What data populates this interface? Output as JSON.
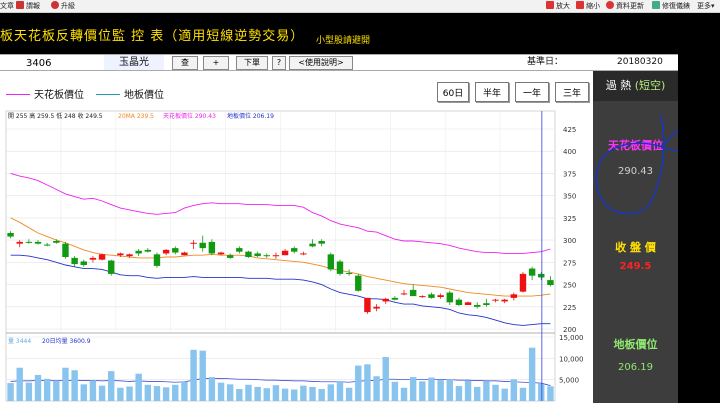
{
  "toolbar": {
    "left_items": [
      "文章",
      "謂報",
      "升級"
    ],
    "right_items": [
      "放大",
      "縮小",
      "資料更新",
      "修復儀錶",
      "更多"
    ]
  },
  "header": {
    "title": "板天花板反轉價位監 控 表（適用短線逆勢交易）",
    "subtitle": "小型股請避開"
  },
  "inputbar": {
    "stock_code": "3406",
    "stock_name": "玉晶光",
    "query_label": "查",
    "add_label": "+",
    "order_label": "下單",
    "help_label": "?",
    "manual_label": "<使用說明>",
    "base_date_label": "基準日：",
    "base_date": "20180320"
  },
  "legend": {
    "ceiling": "天花板價位",
    "floor": "地板價位"
  },
  "range_buttons": [
    "60日",
    "半年",
    "一年",
    "三年"
  ],
  "chart_data": {
    "type": "candlestick",
    "ohlc_readout": "開 255 高 259.5 低 248 收 249.5",
    "ma_label": "20MA 239.5",
    "ceiling_label": "天花板價位 290.43",
    "floor_label": "地板價位 206.19",
    "volume_label": "量 3444",
    "volume_ma_label": "20日均量 3600.9",
    "price_ylim": [
      200,
      425
    ],
    "price_ticks": [
      "425",
      "400",
      "375",
      "350",
      "325",
      "300",
      "275",
      "250",
      "225",
      "200"
    ],
    "volume_ticks": [
      "15,000",
      "10,000",
      "5,000"
    ],
    "volume_ylim": [
      0,
      15000
    ],
    "grid": true,
    "candles": [
      [
        308,
        310,
        302,
        304
      ],
      [
        296,
        300,
        292,
        298
      ],
      [
        298,
        301,
        296,
        297
      ],
      [
        298,
        300,
        295,
        296
      ],
      [
        295,
        297,
        293,
        294
      ],
      [
        299,
        301,
        296,
        297
      ],
      [
        296,
        298,
        279,
        281
      ],
      [
        280,
        282,
        270,
        273
      ],
      [
        276,
        278,
        270,
        272
      ],
      [
        278,
        282,
        275,
        280
      ],
      [
        278,
        285,
        277,
        284
      ],
      [
        277,
        278,
        260,
        262
      ],
      [
        283,
        286,
        281,
        285
      ],
      [
        282,
        285,
        280,
        284
      ],
      [
        288,
        290,
        282,
        285
      ],
      [
        289,
        291,
        286,
        287
      ],
      [
        284,
        286,
        269,
        271
      ],
      [
        285,
        290,
        283,
        289
      ],
      [
        291,
        293,
        284,
        286
      ],
      [
        283,
        287,
        283,
        286
      ],
      [
        296,
        300,
        290,
        297
      ],
      [
        297,
        305,
        287,
        291
      ],
      [
        298,
        301,
        283,
        285
      ],
      [
        284,
        287,
        283,
        286
      ],
      [
        283,
        285,
        279,
        280
      ],
      [
        291,
        293,
        285,
        287
      ],
      [
        287,
        288,
        280,
        281
      ],
      [
        285,
        287,
        281,
        282
      ],
      [
        283,
        285,
        280,
        282
      ],
      [
        283,
        286,
        279,
        283
      ],
      [
        283,
        290,
        283,
        288
      ],
      [
        291,
        293,
        285,
        287
      ],
      [
        285,
        287,
        283,
        285
      ],
      [
        296,
        301,
        292,
        293
      ],
      [
        299,
        301,
        293,
        296
      ],
      [
        284,
        286,
        265,
        267
      ],
      [
        276,
        278,
        260,
        262
      ],
      [
        263,
        267,
        260,
        262
      ],
      [
        260,
        262,
        242,
        243
      ],
      [
        219,
        235,
        217,
        235
      ],
      [
        223,
        228,
        220,
        225
      ],
      [
        231,
        235,
        228,
        234
      ],
      [
        235,
        237,
        232,
        233
      ],
      [
        240,
        244,
        238,
        240
      ],
      [
        244,
        250,
        240,
        237
      ],
      [
        236,
        238,
        235,
        237
      ],
      [
        239,
        241,
        234,
        235
      ],
      [
        236,
        240,
        234,
        238
      ],
      [
        241,
        243,
        227,
        230
      ],
      [
        233,
        235,
        226,
        227
      ],
      [
        227,
        231,
        227,
        230
      ],
      [
        227,
        230,
        223,
        225
      ],
      [
        229,
        234,
        225,
        227
      ],
      [
        232,
        234,
        230,
        233
      ],
      [
        231,
        234,
        229,
        233
      ],
      [
        235,
        241,
        232,
        239
      ],
      [
        242,
        264,
        241,
        262
      ],
      [
        268,
        270,
        255,
        260
      ],
      [
        262,
        264,
        255,
        258
      ],
      [
        255,
        259.5,
        248,
        249.5
      ]
    ],
    "ceiling_series": [
      375,
      372,
      370,
      367,
      362,
      357,
      352,
      349,
      346,
      347,
      344,
      340,
      336,
      334,
      332,
      330,
      329,
      330,
      331,
      336,
      339,
      341,
      342,
      341,
      341,
      341,
      340,
      340,
      340,
      339,
      339,
      339,
      337,
      331,
      327,
      322,
      318,
      316,
      314,
      310,
      309,
      305,
      301,
      299,
      299,
      298,
      297,
      296,
      294,
      291,
      289,
      287,
      286,
      286,
      285,
      285,
      285,
      286,
      287,
      290
    ],
    "floor_series": [
      283,
      283,
      282,
      280,
      278,
      275,
      272,
      270,
      268,
      268,
      267,
      264,
      261,
      260,
      260,
      258,
      257,
      258,
      258,
      258,
      259,
      258,
      258,
      258,
      258,
      258,
      257,
      257,
      257,
      256,
      256,
      256,
      255,
      253,
      250,
      245,
      241,
      239,
      237,
      234,
      234,
      233,
      230,
      228,
      228,
      226,
      225,
      224,
      222,
      218,
      216,
      215,
      213,
      210,
      207,
      205,
      204,
      205,
      206,
      206
    ],
    "ma_series": [
      325,
      320,
      314,
      308,
      304,
      300,
      297,
      293,
      289,
      286,
      284,
      283,
      282,
      281,
      280,
      280,
      280,
      281,
      281,
      282,
      283,
      283,
      284,
      283,
      283,
      283,
      282,
      280,
      279,
      278,
      277,
      276,
      275,
      273,
      271,
      268,
      266,
      264,
      262,
      259,
      257,
      255,
      253,
      251,
      250,
      249,
      248,
      247,
      245,
      243,
      241,
      240,
      239,
      238,
      237,
      237,
      237,
      237,
      238,
      239.5
    ],
    "volumes": [
      4200,
      7800,
      4300,
      6100,
      5200,
      4600,
      7800,
      7200,
      3900,
      4800,
      3600,
      7000,
      3100,
      3400,
      6400,
      3800,
      3500,
      3200,
      3800,
      4500,
      12000,
      11800,
      5600,
      4300,
      3900,
      2800,
      3800,
      3300,
      3000,
      3700,
      2900,
      2700,
      3600,
      3300,
      2800,
      3900,
      4700,
      3100,
      8300,
      8600,
      5800,
      10300,
      4500,
      3100,
      5600,
      4600,
      5500,
      4900,
      5000,
      3500,
      4700,
      3300,
      4600,
      3800,
      2900,
      5100,
      3100,
      12500,
      4000,
      3444
    ],
    "volume_ma_series": [
      4600,
      4700,
      4700,
      4800,
      4800,
      4700,
      4800,
      4900,
      4800,
      4800,
      4700,
      4800,
      4700,
      4600,
      4700,
      4600,
      4600,
      4500,
      4400,
      4500,
      4900,
      5300,
      5300,
      5300,
      5200,
      5100,
      5100,
      5000,
      4900,
      4900,
      4800,
      4700,
      4700,
      4600,
      4500,
      4500,
      4500,
      4400,
      4600,
      4800,
      4800,
      5100,
      5100,
      5000,
      5000,
      5000,
      5000,
      5000,
      5000,
      4900,
      4900,
      4800,
      4700,
      4700,
      4600,
      4500,
      4400,
      4300,
      4200,
      3600.9
    ],
    "colors": {
      "up": "#ee1111",
      "down": "#119911",
      "ceiling": "#ee22ee",
      "floor": "#2233cc",
      "ma": "#f08a20",
      "volume": "#88c4ee",
      "cursor": "#3344dd"
    }
  },
  "right_panel": {
    "status": "過 熱",
    "status_paren": "(短空)",
    "ceiling_label": "天花板價位",
    "ceiling_value": "290.43",
    "close_label": "收 盤 價",
    "close_value": "249.5",
    "floor_label": "地板價位",
    "floor_value": "206.19",
    "colors": {
      "ceiling": "#ff33ff",
      "close_label": "#ffe000",
      "close_value": "#ff2222",
      "floor": "#8fe870",
      "annotation": "#1133dd"
    }
  }
}
